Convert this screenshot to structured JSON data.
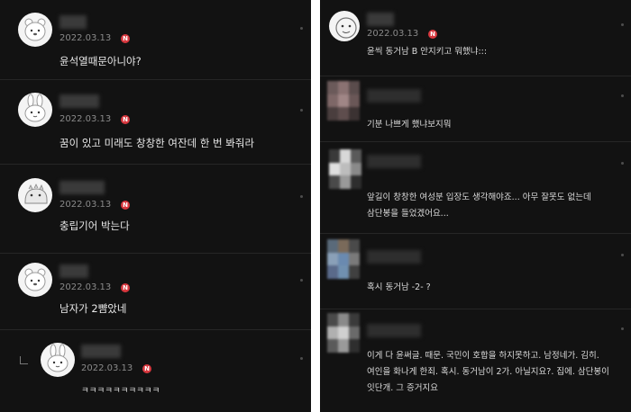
{
  "left": {
    "comments": [
      {
        "date": "2022.03.13",
        "badge": "N",
        "text": "윤석열때문아니야?"
      },
      {
        "date": "2022.03.13",
        "badge": "N",
        "text": "꿈이 있고 미래도 창창한 여잔데 한 번 봐줘라"
      },
      {
        "date": "2022.03.13",
        "badge": "N",
        "text": "충립기어 박는다"
      },
      {
        "date": "2022.03.13",
        "badge": "N",
        "text": "남자가 2뺨았네"
      },
      {
        "date": "2022.03.13",
        "badge": "N",
        "text": "ㅋㅋㅋㅋㅋㅋㅋㅋㅋㅋ"
      }
    ]
  },
  "right": {
    "comments": [
      {
        "date": "2022.03.13",
        "badge": "N",
        "text": "윤씩 동거남 B 안지키고 뭐했냐:::"
      },
      {
        "text": "기분 나쁘게 했냐보지뭐"
      },
      {
        "text_lines": [
          "앞길이 창창한 여성분 입장도 생각해야죠... 아무 잘못도 없는데",
          "삼단봉을 들었겠어요..."
        ]
      },
      {
        "text": "혹시 동거남 -2- ?"
      },
      {
        "text_lines": [
          "이게 다 윤써글. 때문. 국민이 호합을 하지못하고. 남정네가. 김히.",
          "여인을 화나게 한죄. 혹시. 동거남이 2가. 아닐지요?. 집에. 삼단봉이",
          "잇단개. 그 증거지요"
        ]
      }
    ]
  },
  "colors": {
    "background": "#121212",
    "text": "#e8e8e8",
    "date": "#8a8a8a",
    "badge": "#d8383f",
    "separator": "#262626"
  },
  "icons": [
    "bear-avatar-icon",
    "bunny-avatar-icon",
    "dino-avatar-icon",
    "new-badge-icon",
    "more-options-icon",
    "reply-arrow-icon"
  ]
}
